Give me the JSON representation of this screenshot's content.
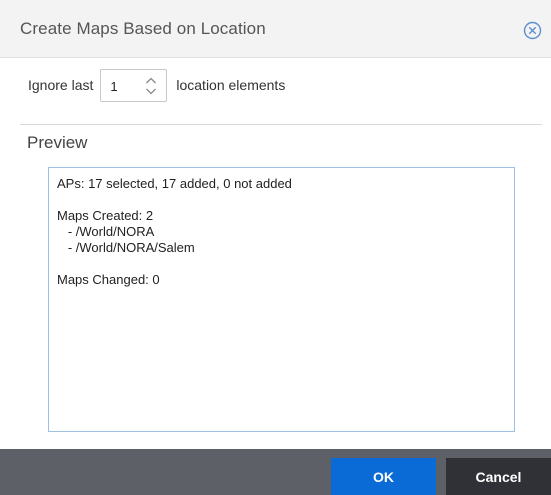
{
  "dialog": {
    "title": "Create Maps Based on Location",
    "close_icon": "close-circle-icon",
    "ignore": {
      "prefix": "Ignore last",
      "value": "1",
      "suffix": "location elements"
    },
    "preview": {
      "label": "Preview",
      "lines": [
        "APs: 17 selected, 17 added, 0 not added",
        "",
        "Maps Created: 2",
        "   - /World/NORA",
        "   - /World/NORA/Salem",
        "",
        "Maps Changed: 0"
      ]
    },
    "buttons": {
      "ok": "OK",
      "cancel": "Cancel"
    }
  },
  "colors": {
    "ok_button": "#0a6bd6",
    "cancel_button": "#2f3136",
    "footer": "#5d6067",
    "close_icon": "#5a8fd0",
    "preview_border": "#9ec2e6"
  }
}
